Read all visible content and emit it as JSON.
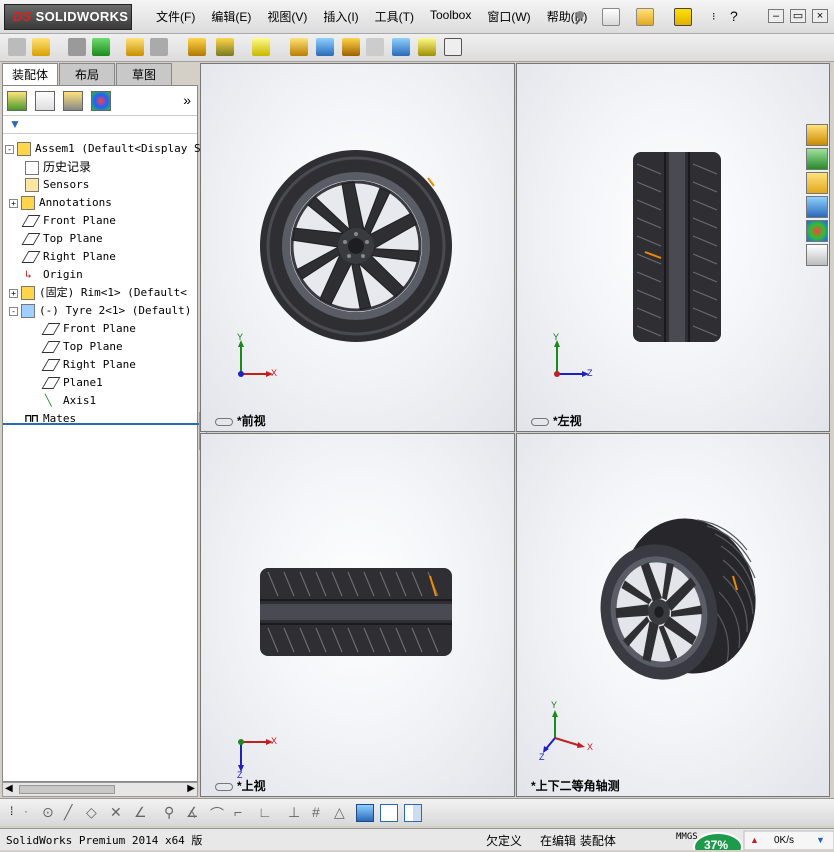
{
  "app": {
    "logo_text": "SOLIDWORKS",
    "logo_prefix": "DS"
  },
  "menu": [
    "文件(F)",
    "编辑(E)",
    "视图(V)",
    "插入(I)",
    "工具(T)",
    "Toolbox",
    "窗口(W)",
    "帮助(H)"
  ],
  "tabs": [
    "装配体",
    "布局",
    "草图"
  ],
  "tree": [
    {
      "label": "Assem1  (Default<Display S",
      "indent": 0,
      "expander": "-",
      "icon": "assembly-icon"
    },
    {
      "label": "历史记录",
      "indent": 1,
      "icon": "history-icon"
    },
    {
      "label": "Sensors",
      "indent": 1,
      "icon": "sensors-icon"
    },
    {
      "label": "Annotations",
      "indent": 1,
      "expander": "+",
      "icon": "annotations-icon"
    },
    {
      "label": "Front Plane",
      "indent": 1,
      "icon": "plane-icon"
    },
    {
      "label": "Top Plane",
      "indent": 1,
      "icon": "plane-icon"
    },
    {
      "label": "Right Plane",
      "indent": 1,
      "icon": "plane-icon"
    },
    {
      "label": "Origin",
      "indent": 1,
      "icon": "origin-icon"
    },
    {
      "label": "(固定) Rim<1> (Default<",
      "indent": 1,
      "expander": "+",
      "icon": "part-icon"
    },
    {
      "label": "(-) Tyre 2<1> (Default)",
      "indent": 1,
      "expander": "-",
      "icon": "part-icon"
    },
    {
      "label": "Front Plane",
      "indent": 2,
      "icon": "plane-icon"
    },
    {
      "label": "Top Plane",
      "indent": 2,
      "icon": "plane-icon"
    },
    {
      "label": "Right Plane",
      "indent": 2,
      "icon": "plane-icon"
    },
    {
      "label": "Plane1",
      "indent": 2,
      "icon": "plane-icon"
    },
    {
      "label": "Axis1",
      "indent": 2,
      "icon": "axis-icon"
    },
    {
      "label": "Mates",
      "indent": 1,
      "icon": "mates-icon"
    }
  ],
  "viewports": {
    "front": {
      "label": "*前视",
      "axes": [
        "Y",
        "X"
      ]
    },
    "left": {
      "label": "*左视",
      "axes": [
        "Y",
        "Z"
      ]
    },
    "top": {
      "label": "*上视",
      "axes": [
        "X",
        "Z"
      ]
    },
    "iso": {
      "label": "*上下二等角轴测",
      "axes": [
        "Y",
        "X",
        "Z"
      ]
    }
  },
  "status": {
    "product": "SolidWorks Premium 2014 x64 版",
    "defined": "欠定义",
    "editing": "在编辑 装配体",
    "units": "MMGS",
    "cpu_percent": "37%",
    "net_speed": "0K/s"
  },
  "colors": {
    "accent_blue": "#2a6ab8",
    "tire_dark": "#2e2e33",
    "rim_gray": "#5a5c66",
    "net_green": "#1e9b4a"
  }
}
